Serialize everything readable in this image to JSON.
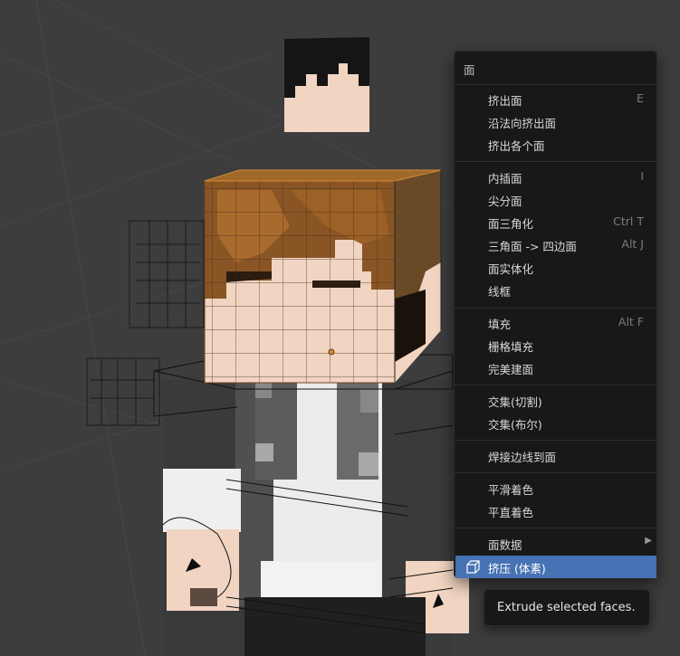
{
  "menu": {
    "title": "面",
    "items": [
      {
        "label": "挤出面",
        "shortcut": "E"
      },
      {
        "label": "沿法向挤出面",
        "shortcut": ""
      },
      {
        "label": "挤出各个面",
        "shortcut": ""
      },
      {
        "label": "内插面",
        "shortcut": "I"
      },
      {
        "label": "尖分面",
        "shortcut": ""
      },
      {
        "label": "面三角化",
        "shortcut": "Ctrl T"
      },
      {
        "label": "三角面 -> 四边面",
        "shortcut": "Alt J"
      },
      {
        "label": "面实体化",
        "shortcut": ""
      },
      {
        "label": "线框",
        "shortcut": ""
      },
      {
        "label": "填充",
        "shortcut": "Alt F"
      },
      {
        "label": "栅格填充",
        "shortcut": ""
      },
      {
        "label": "完美建面",
        "shortcut": ""
      },
      {
        "label": "交集(切割)",
        "shortcut": ""
      },
      {
        "label": "交集(布尔)",
        "shortcut": ""
      },
      {
        "label": "焊接边线到面",
        "shortcut": ""
      },
      {
        "label": "平滑着色",
        "shortcut": ""
      },
      {
        "label": "平直着色",
        "shortcut": ""
      },
      {
        "label": "面数据",
        "shortcut": "",
        "submenu": true
      },
      {
        "label": "挤压 (体素)",
        "shortcut": "",
        "icon": "cube-icon",
        "active": true
      }
    ]
  },
  "tooltip": {
    "text": "Extrude selected faces."
  },
  "colors": {
    "viewport_bg": "#3d3d3d",
    "menu_bg": "#181818",
    "highlight": "#4772b3",
    "selection_orange": "#e08a1e"
  }
}
